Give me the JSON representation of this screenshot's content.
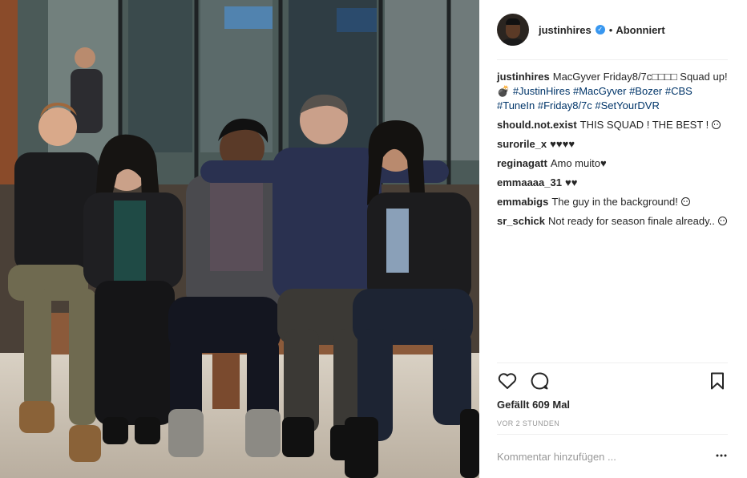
{
  "post": {
    "username": "justinhires",
    "follow_status": "Abonniert",
    "separator": "•",
    "caption": {
      "username": "justinhires",
      "text_before": "MacGyver Friday8/7c□□□□ Squad up!💣",
      "hashtags": [
        "#JustinHires",
        "#MacGyver",
        "#Bozer",
        "#CBS",
        "#TuneIn",
        "#Friday8/7c",
        "#SetYourDVR"
      ]
    },
    "comments": [
      {
        "username": "should.not.exist",
        "text": "THIS SQUAD ! THE BEST !",
        "face": true
      },
      {
        "username": "surorile_x",
        "text": "♥♥♥♥",
        "face": false
      },
      {
        "username": "reginagatt",
        "text": "Amo muito♥",
        "face": false
      },
      {
        "username": "emmaaaa_31",
        "text": "♥♥",
        "face": false
      },
      {
        "username": "emmabigs",
        "text": "The guy in the background!",
        "face": true
      },
      {
        "username": "sr_schick",
        "text": "Not ready for season finale already..",
        "face": true
      }
    ],
    "likes_text": "Gefällt 609 Mal",
    "timestamp": "VOR 2 STUNDEN",
    "comment_placeholder": "Kommentar hinzufügen ...",
    "more_label": "•••"
  },
  "icons": {
    "like": "heart-icon",
    "comment": "comment-bubble-icon",
    "save": "bookmark-icon",
    "verified": "verified-badge-icon",
    "more": "more-options-icon"
  },
  "colors": {
    "hashtag": "#003569",
    "verified": "#3897f0",
    "muted": "#999999",
    "text": "#262626"
  }
}
